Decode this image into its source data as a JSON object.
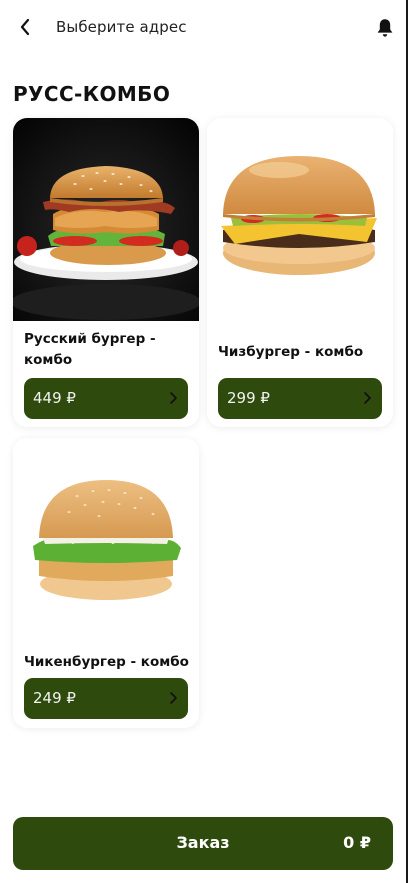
{
  "header": {
    "address_label": "Выберите адрес"
  },
  "section": {
    "title": "РУСС-КОМБО"
  },
  "products": [
    {
      "name": "Русский бургер - комбо",
      "price": "449 ₽"
    },
    {
      "name": "Чизбургер - комбо",
      "price": "299 ₽"
    },
    {
      "name": "Чикенбургер - комбо",
      "price": "249 ₽"
    }
  ],
  "order": {
    "label": "Заказ",
    "total": "0 ₽"
  },
  "colors": {
    "accent": "#2f4a0d",
    "background": "#ffffff"
  },
  "icons": [
    "back-icon",
    "bell-icon",
    "chevron-right-icon"
  ]
}
